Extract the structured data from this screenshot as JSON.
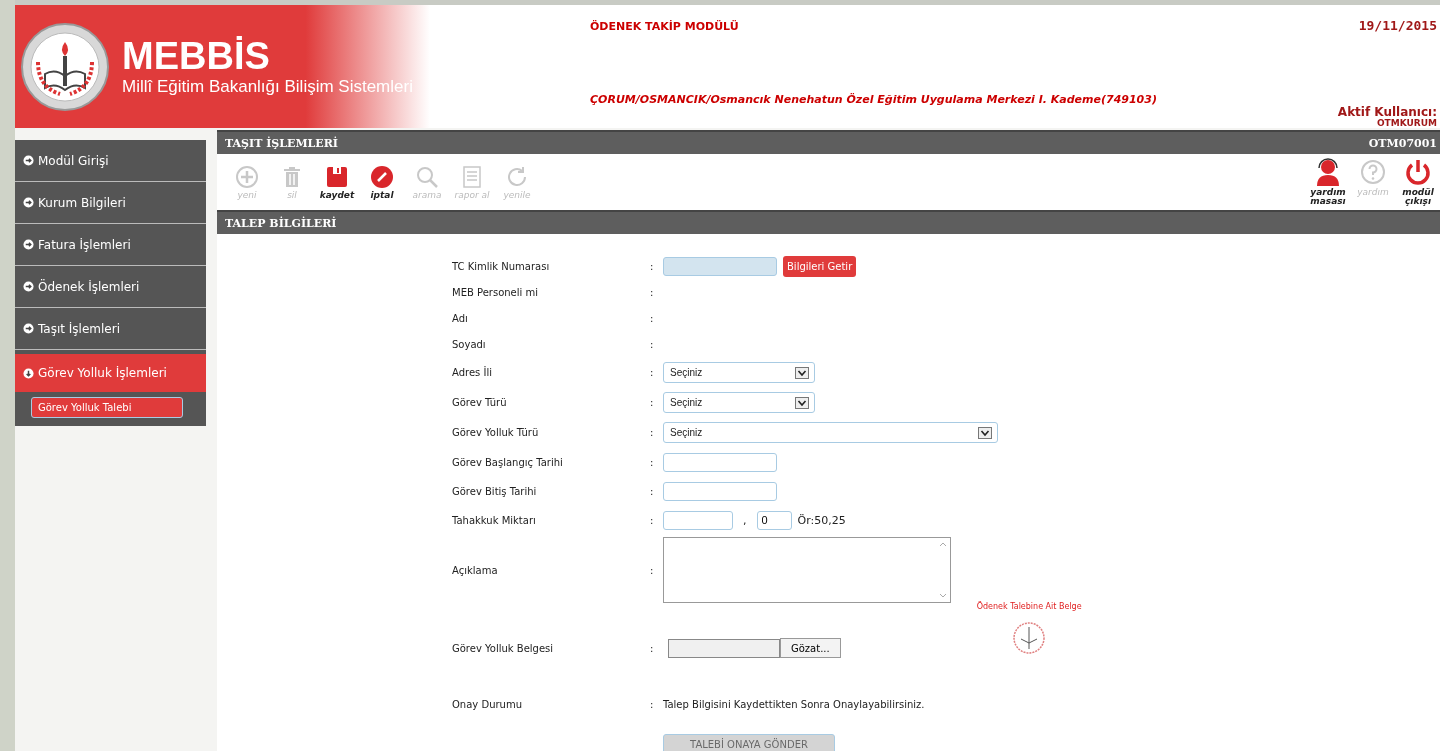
{
  "header": {
    "logo_title": "MEBBİS",
    "logo_subtitle": "Millî Eğitim Bakanlığı Bilişim Sistemleri",
    "module": "ÖDENEK TAKİP MODÜLÜ",
    "date": "19/11/2015",
    "institution": "ÇORUM/OSMANCIK/Osmancık Nenehatun Özel Eğitim Uygulama Merkezi I. Kademe(749103)",
    "user_label": "Aktif Kullanıcı:",
    "user": "OTMKURUM"
  },
  "sidebar": {
    "items": [
      {
        "label": "Modül Girişi",
        "expanded": false
      },
      {
        "label": "Kurum Bilgileri",
        "expanded": false
      },
      {
        "label": "Fatura İşlemleri",
        "expanded": false
      },
      {
        "label": "Ödenek İşlemleri",
        "expanded": false
      },
      {
        "label": "Taşıt İşlemleri",
        "expanded": false
      },
      {
        "label": "Görev Yolluk İşlemleri",
        "expanded": true,
        "children": [
          {
            "label": "Görev Yolluk Talebi",
            "selected": true
          }
        ]
      }
    ]
  },
  "page": {
    "title": "TAŞIT İŞLEMLERİ",
    "code": "OTM07001"
  },
  "toolbar": [
    {
      "label": "yeni",
      "disabled": true
    },
    {
      "label": "sil",
      "disabled": true
    },
    {
      "label": "kaydet",
      "disabled": false
    },
    {
      "label": "iptal",
      "disabled": false
    },
    {
      "label": "arama",
      "disabled": true
    },
    {
      "label": "rapor al",
      "disabled": true
    },
    {
      "label": "yenile",
      "disabled": true
    }
  ],
  "toolbar_right": [
    {
      "label": "yardım masası",
      "disabled": false
    },
    {
      "label": "yardım",
      "disabled": true
    },
    {
      "label": "modül çıkışı",
      "disabled": false
    }
  ],
  "section": {
    "title": "TALEP BİLGİLERİ"
  },
  "label_separator": ":",
  "form": [
    {
      "kind": "lookup",
      "label": "TC Kimlik Numarası",
      "button": "Bilgileri Getir"
    },
    {
      "kind": "static",
      "label": "MEB Personeli mi"
    },
    {
      "kind": "static",
      "label": "Adı"
    },
    {
      "kind": "static",
      "label": "Soyadı"
    },
    {
      "kind": "select",
      "label": "Adres İli",
      "value": "Seçiniz",
      "wide": false
    },
    {
      "kind": "select",
      "label": "Görev Türü",
      "value": "Seçiniz",
      "wide": false
    },
    {
      "kind": "select",
      "label": "Görev Yolluk Türü",
      "value": "Seçiniz",
      "wide": true
    },
    {
      "kind": "input",
      "label": "Görev Başlangıç Tarihi"
    },
    {
      "kind": "input",
      "label": "Görev Bitiş Tarihi"
    },
    {
      "kind": "amount",
      "label": "Tahakkuk Miktarı",
      "separator": ",",
      "decimal": "0",
      "hint": "Ör:50,25"
    },
    {
      "kind": "textarea",
      "label": "Açıklama"
    },
    {
      "kind": "file",
      "label": "Görev Yolluk Belgesi",
      "button": "Gözat...",
      "document_label": "Ödenek Talebine Ait Belge"
    },
    {
      "kind": "text",
      "label": "Onay Durumu",
      "value": "Talep Bilgisini Kaydettikten Sonra Onaylayabilirsiniz."
    }
  ],
  "submit": {
    "label": "TALEBİ ONAYA GÖNDER",
    "disabled": true
  }
}
